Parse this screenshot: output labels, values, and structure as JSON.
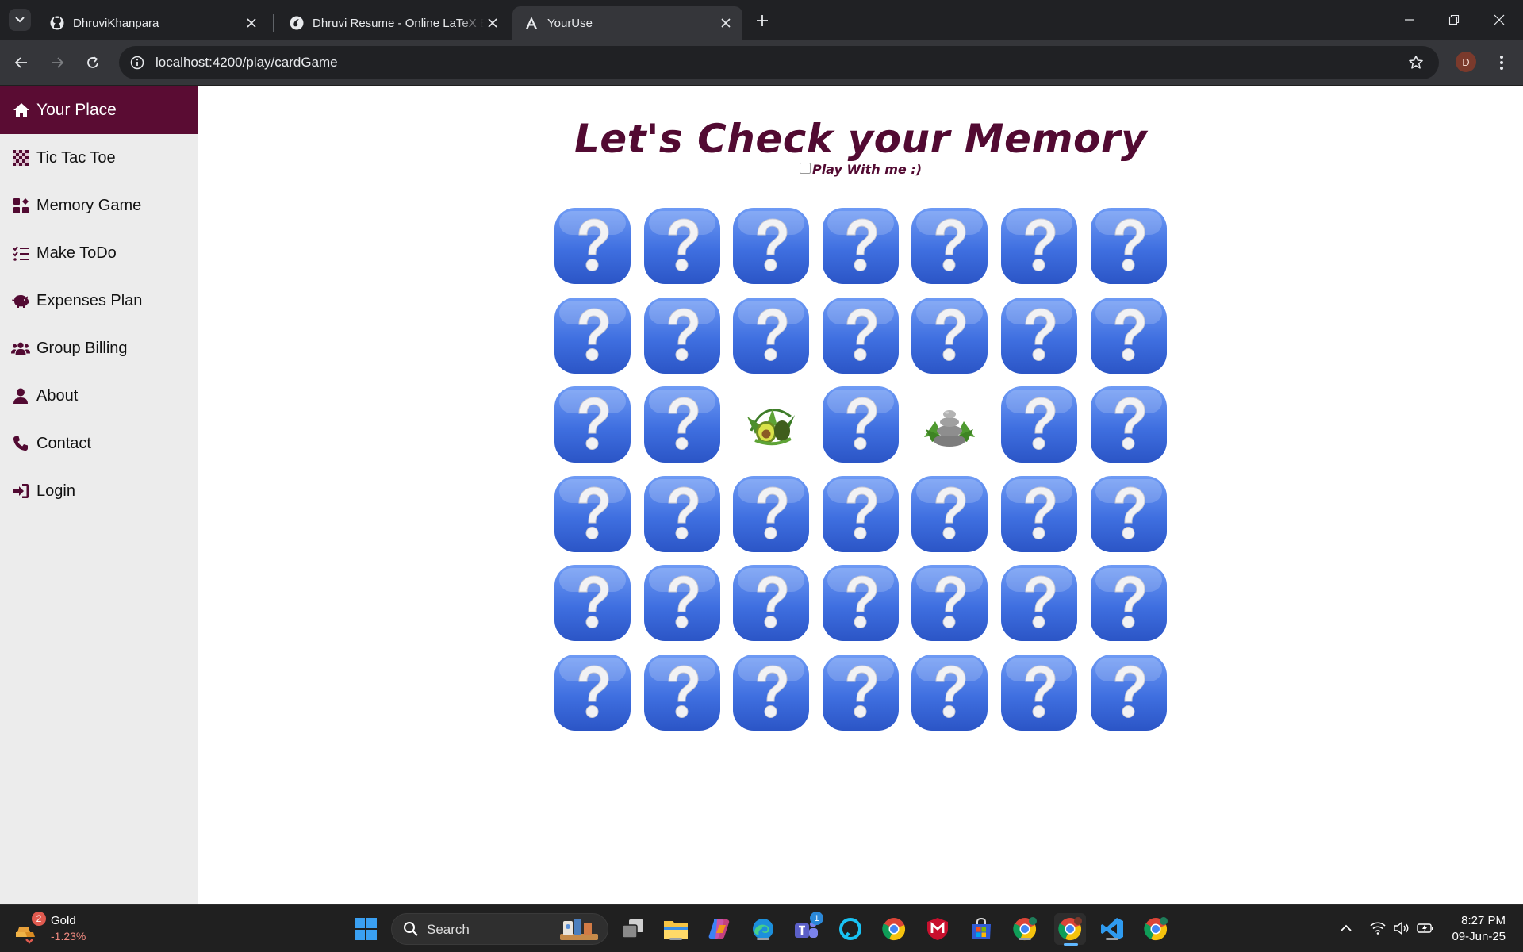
{
  "browser": {
    "tabs": [
      {
        "title": "DhruviKhanpara",
        "icon": "github-icon"
      },
      {
        "title": "Dhruvi Resume - Online LaTeX E",
        "icon": "overleaf-icon"
      },
      {
        "title": "YourUse",
        "icon": "angular-icon",
        "active": true
      }
    ],
    "url": "localhost:4200/play/cardGame",
    "profile_initial": "D"
  },
  "sidebar": {
    "brand": "Your Place",
    "items": [
      {
        "label": "Tic Tac Toe",
        "icon": "checkerboard-icon"
      },
      {
        "label": "Memory Game",
        "icon": "puzzle-grid-icon"
      },
      {
        "label": "Make ToDo",
        "icon": "list-check-icon"
      },
      {
        "label": "Expenses Plan",
        "icon": "piggy-bank-icon"
      },
      {
        "label": "Group Billing",
        "icon": "users-icon"
      },
      {
        "label": "About",
        "icon": "user-icon"
      },
      {
        "label": "Contact",
        "icon": "phone-icon"
      },
      {
        "label": "Login",
        "icon": "sign-in-icon"
      }
    ]
  },
  "main": {
    "title": "Let's Check your Memory",
    "play_with_me_label": "Play With me :)",
    "play_with_me_checked": false,
    "grid": {
      "rows": 6,
      "columns": 7,
      "cards": [
        "hidden",
        "hidden",
        "hidden",
        "hidden",
        "hidden",
        "hidden",
        "hidden",
        "hidden",
        "hidden",
        "hidden",
        "hidden",
        "hidden",
        "hidden",
        "hidden",
        "hidden",
        "hidden",
        "avocado",
        "hidden",
        "zen-stones",
        "hidden",
        "hidden",
        "hidden",
        "hidden",
        "hidden",
        "hidden",
        "hidden",
        "hidden",
        "hidden",
        "hidden",
        "hidden",
        "hidden",
        "hidden",
        "hidden",
        "hidden",
        "hidden",
        "hidden",
        "hidden",
        "hidden",
        "hidden",
        "hidden",
        "hidden",
        "hidden"
      ]
    }
  },
  "taskbar": {
    "widget_badge": "2",
    "widget_name": "Gold",
    "widget_change": "-1.23%",
    "search_placeholder": "Search",
    "teams_badge": "1",
    "time": "8:27 PM",
    "date": "09-Jun-25"
  },
  "colors": {
    "brand": "#5a0c33",
    "title": "#520a32",
    "card_blue": "#3f6fe0"
  }
}
